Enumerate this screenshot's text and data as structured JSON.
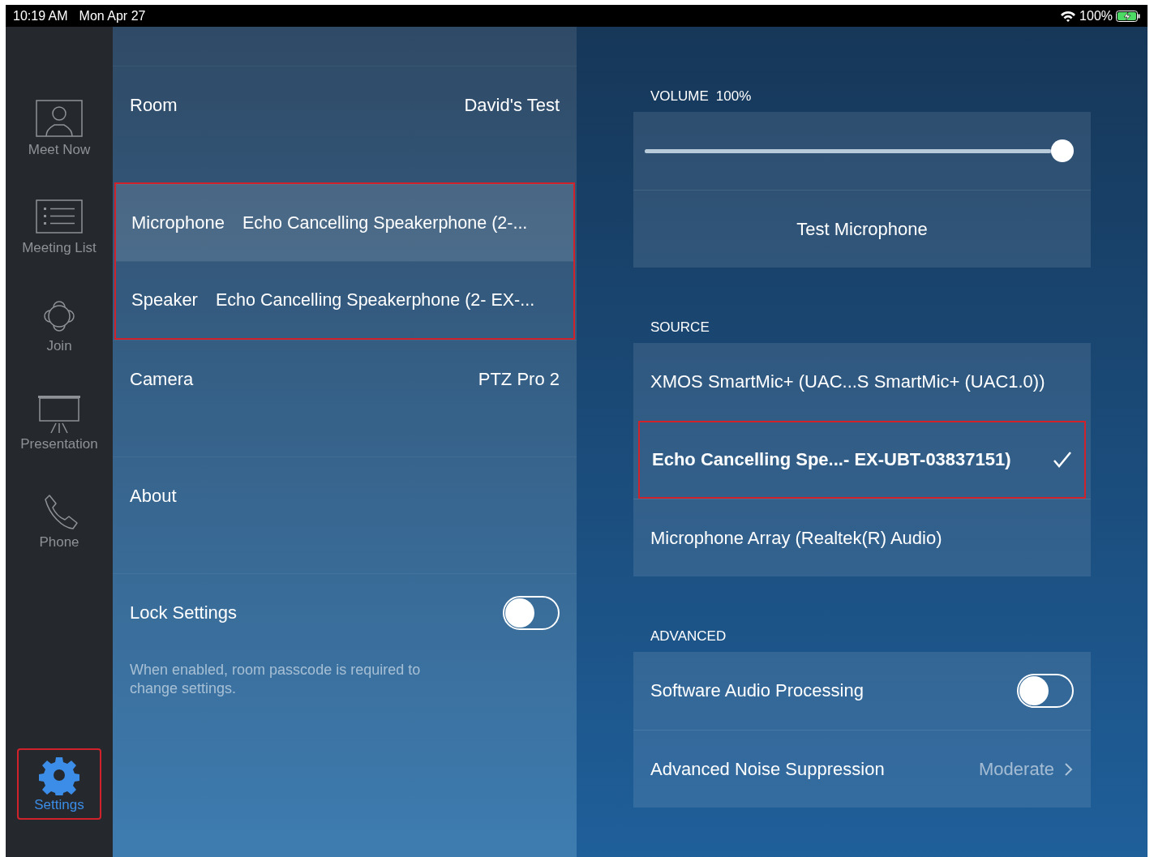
{
  "status_bar": {
    "time": "10:19 AM",
    "date": "Mon Apr 27",
    "battery": "100%",
    "charging": true
  },
  "sidebar": {
    "items": [
      {
        "kind": "person",
        "label": "Meet Now",
        "selected": false,
        "highlighted": false
      },
      {
        "kind": "list",
        "label": "Meeting List",
        "selected": false,
        "highlighted": false
      },
      {
        "kind": "join",
        "label": "Join",
        "selected": false,
        "highlighted": false
      },
      {
        "kind": "presentation",
        "label": "Presentation",
        "selected": false,
        "highlighted": false
      },
      {
        "kind": "phone",
        "label": "Phone",
        "selected": false,
        "highlighted": false
      },
      {
        "kind": "settings",
        "label": "Settings",
        "selected": true,
        "highlighted": true
      }
    ]
  },
  "settings": {
    "groups": [
      {
        "rows": [
          {
            "kind": "value",
            "label": "Room",
            "value": "David's Test",
            "selected": false,
            "highlighted": false
          }
        ]
      },
      {
        "rows": [
          {
            "kind": "inline",
            "label": "Microphone",
            "value": "Echo Cancelling Speakerphone (2-...",
            "selected": true,
            "highlighted": true
          },
          {
            "kind": "inline",
            "label": "Speaker",
            "value": "Echo Cancelling Speakerphone (2- EX-...",
            "selected": false,
            "highlighted": true
          },
          {
            "kind": "value",
            "label": "Camera",
            "value": "PTZ Pro 2",
            "selected": false,
            "highlighted": false
          }
        ]
      },
      {
        "rows": [
          {
            "kind": "plain",
            "label": "About",
            "selected": false,
            "highlighted": false
          }
        ]
      },
      {
        "rows": [
          {
            "kind": "toggle",
            "label": "Lock Settings",
            "on": false,
            "selected": false,
            "highlighted": false
          }
        ],
        "note": "When enabled, room passcode is required to change settings."
      }
    ]
  },
  "audio": {
    "volume": {
      "label": "VOLUME",
      "reading": "100%",
      "level": 1
    },
    "test_button": "Test Microphone",
    "source": {
      "label": "SOURCE",
      "items": [
        {
          "label": "XMOS SmartMic+ (UAC...S SmartMic+ (UAC1.0))",
          "selected": false,
          "highlighted": false
        },
        {
          "label": "Echo Cancelling Spe...- EX-UBT-03837151)",
          "selected": true,
          "highlighted": true
        },
        {
          "label": "Microphone Array (Realtek(R) Audio)",
          "selected": false,
          "highlighted": false
        }
      ]
    },
    "advanced": {
      "label": "ADVANCED",
      "rows": [
        {
          "kind": "toggle",
          "label": "Software Audio Processing",
          "on": false
        },
        {
          "kind": "link",
          "label": "Advanced Noise Suppression",
          "value": "Moderate"
        }
      ]
    }
  }
}
